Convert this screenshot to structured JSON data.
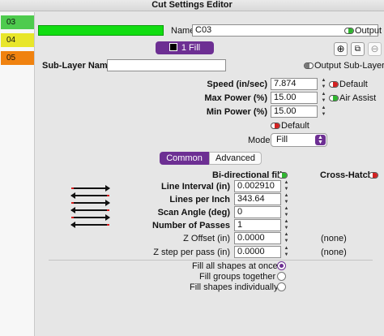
{
  "window": {
    "title": "Cut Settings Editor"
  },
  "layers": [
    {
      "label": "03",
      "color": "#4ecb4e"
    },
    {
      "label": "04",
      "color": "#e8e62a"
    },
    {
      "label": "05",
      "color": "#f0820f"
    }
  ],
  "header": {
    "swatch_color": "#11dd11",
    "name_label": "Name",
    "name_value": "C03",
    "output_label": "Output",
    "fill_button": "1 Fill"
  },
  "sublayer": {
    "name_label": "Sub-Layer Name",
    "name_value": "",
    "output_label": "Output Sub-Layer"
  },
  "params": {
    "speed_label": "Speed (in/sec)",
    "speed_value": "7.874",
    "default_label": "Default",
    "max_power_label": "Max Power (%)",
    "max_power_value": "15.00",
    "air_assist_label": "Air Assist",
    "min_power_label": "Min Power (%)",
    "min_power_value": "15.00",
    "power_default_label": "Default",
    "mode_label": "Mode",
    "mode_value": "Fill"
  },
  "tabs": {
    "common": "Common",
    "advanced": "Advanced"
  },
  "fill": {
    "bidir_label": "Bi-directional fill",
    "crosshatch_label": "Cross-Hatch",
    "line_interval_label": "Line Interval (in)",
    "line_interval_value": "0.002910",
    "lpi_label": "Lines per Inch",
    "lpi_value": "343.64",
    "scan_angle_label": "Scan Angle (deg)",
    "scan_angle_value": "0",
    "passes_label": "Number of Passes",
    "passes_value": "1",
    "z_offset_label": "Z Offset (in)",
    "z_offset_value": "0.0000",
    "z_offset_none": "(none)",
    "z_step_label": "Z step per pass (in)",
    "z_step_value": "0.0000",
    "z_step_none": "(none)"
  },
  "fill_options": {
    "all_at_once": "Fill all shapes at once",
    "groups_together": "Fill groups together",
    "individually": "Fill shapes individually"
  },
  "colors": {
    "accent": "#6d2f93",
    "toggle_on": "#2fb52f",
    "toggle_off": "#d22222"
  }
}
